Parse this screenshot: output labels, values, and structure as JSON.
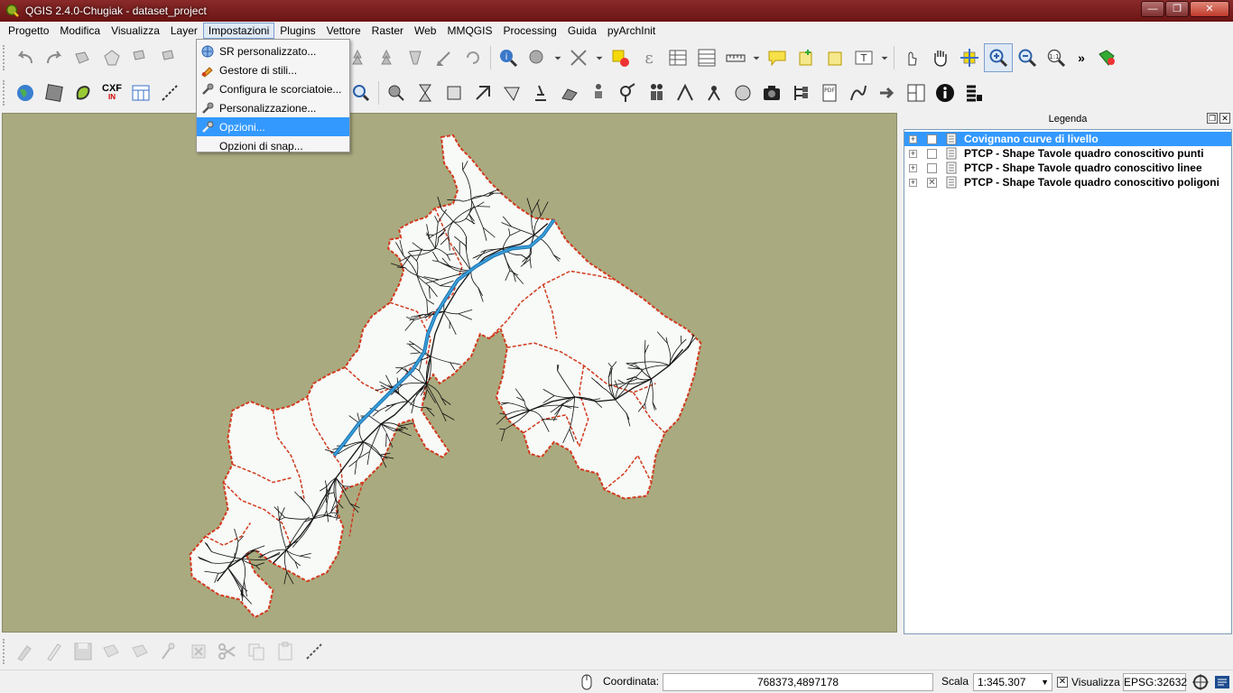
{
  "window": {
    "title": "QGIS 2.4.0-Chugiak - dataset_project",
    "buttons": {
      "minimize": "—",
      "maximize": "❐",
      "close": "✕"
    }
  },
  "menubar": {
    "items": [
      "Progetto",
      "Modifica",
      "Visualizza",
      "Layer",
      "Impostazioni",
      "Plugins",
      "Vettore",
      "Raster",
      "Web",
      "MMQGIS",
      "Processing",
      "Guida",
      "pyArchInit"
    ],
    "active": "Impostazioni"
  },
  "settings_menu": {
    "items": [
      {
        "label": "SR personalizzato...",
        "icon": "crs-globe-icon"
      },
      {
        "label": "Gestore di stili...",
        "icon": "style-manager-icon"
      },
      {
        "label": "Configura le scorciatoie...",
        "icon": "wrench-icon"
      },
      {
        "label": "Personalizzazione...",
        "icon": "wrench-icon"
      },
      {
        "label": "Opzioni...",
        "icon": "wrench-icon"
      },
      {
        "label": "Opzioni di snap...",
        "icon": ""
      }
    ],
    "highlighted_index": 4
  },
  "toolbar": {
    "cxf_label_top": "CXF",
    "cxf_label_bottom": "IN",
    "overflow_label": "»"
  },
  "legend": {
    "title": "Legenda",
    "header_buttons": {
      "float": "❐",
      "close": "✕"
    },
    "layers": [
      {
        "name": "Covignano curve di livello",
        "checked": false,
        "selected": true
      },
      {
        "name": "PTCP - Shape  Tavole quadro conoscitivo punti",
        "checked": false,
        "selected": false
      },
      {
        "name": "PTCP - Shape Tavole quadro conoscitivo linee",
        "checked": false,
        "selected": false
      },
      {
        "name": "PTCP - Shape  Tavole quadro conoscitivo poligoni",
        "checked": true,
        "selected": false
      }
    ],
    "expander_symbol": "+",
    "checked_symbol": "✕"
  },
  "statusbar": {
    "coordinate_label": "Coordinata:",
    "coordinate_value": "768373,4897178",
    "scale_label": "Scala",
    "scale_value": "1:345.307",
    "render_label": "Visualizza",
    "render_checked_symbol": "✕",
    "crs_label": "EPSG:32632"
  },
  "colors": {
    "map_background": "#a9aa7f",
    "selection": "#3399ff",
    "title_bar": "#7a1f1f",
    "region_fill": "#f7faf7",
    "boundary": "#d23a1e",
    "river": "#3aa0d8"
  }
}
